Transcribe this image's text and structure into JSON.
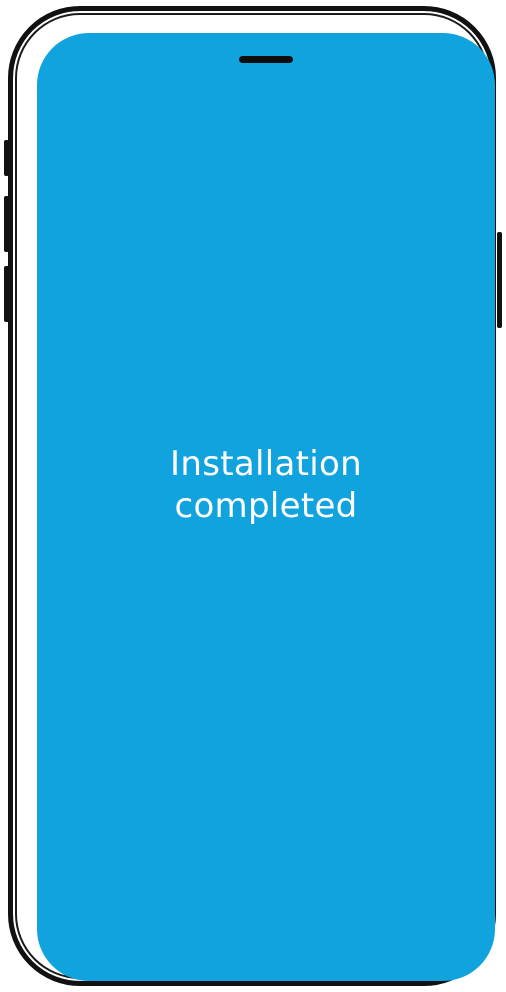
{
  "screen": {
    "background_color": "#10A3DD",
    "message_line_1": "Installation",
    "message_line_2": "completed"
  },
  "frame": {
    "color": "#111111"
  }
}
